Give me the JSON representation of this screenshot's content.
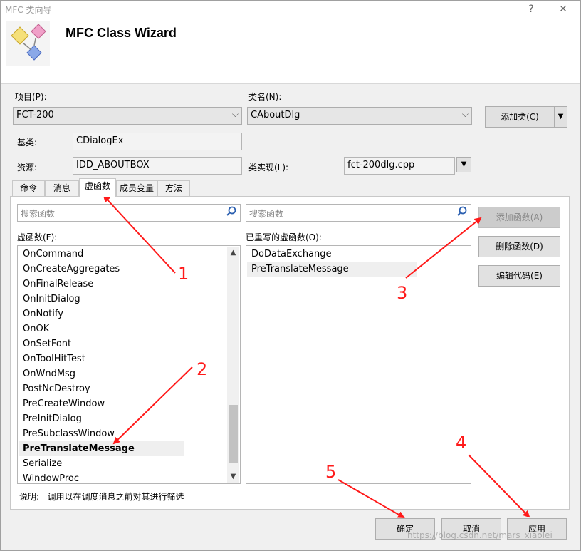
{
  "window": {
    "caption": "MFC 类向导",
    "help_glyph": "?",
    "close_glyph": "✕",
    "heading": "MFC Class Wizard"
  },
  "form": {
    "project_label": "项目(P):",
    "project_value": "FCT-200",
    "class_label": "类名(N):",
    "class_value": "CAboutDlg",
    "add_class": "添加类(C)",
    "base_label": "基类:",
    "base_value": "CDialogEx",
    "resource_label": "资源:",
    "resource_value": "IDD_ABOUTBOX",
    "impl_label": "类实现(L):",
    "impl_value": "fct-200dlg.cpp"
  },
  "tabs": [
    "命令",
    "消息",
    "虚函数",
    "成员变量",
    "方法"
  ],
  "active_tab": "虚函数",
  "search": {
    "left_placeholder": "搜索函数",
    "right_placeholder": "搜索函数"
  },
  "virtual_functions": {
    "label": "虚函数(F):",
    "items": [
      "OnCommand",
      "OnCreateAggregates",
      "OnFinalRelease",
      "OnInitDialog",
      "OnNotify",
      "OnOK",
      "OnSetFont",
      "OnToolHitTest",
      "OnWndMsg",
      "PostNcDestroy",
      "PreCreateWindow",
      "PreInitDialog",
      "PreSubclassWindow",
      "PreTranslateMessage",
      "Serialize",
      "WindowProc"
    ],
    "selected": "PreTranslateMessage"
  },
  "overridden": {
    "label": "已重写的虚函数(O):",
    "items": [
      "DoDataExchange",
      "PreTranslateMessage"
    ]
  },
  "actions": {
    "add_function": "添加函数(A)",
    "delete_function": "删除函数(D)",
    "edit_code": "编辑代码(E)"
  },
  "description": "说明:   调用以在调度消息之前对其进行筛选",
  "footer": {
    "ok": "确定",
    "cancel": "取消",
    "apply": "应用"
  },
  "annotations": [
    "1",
    "2",
    "3",
    "4",
    "5"
  ],
  "watermark": "https://blog.csdn.net/mars_xiaolei",
  "colors": {
    "arrow": "#ff1a1a",
    "selection": "#efefef"
  }
}
